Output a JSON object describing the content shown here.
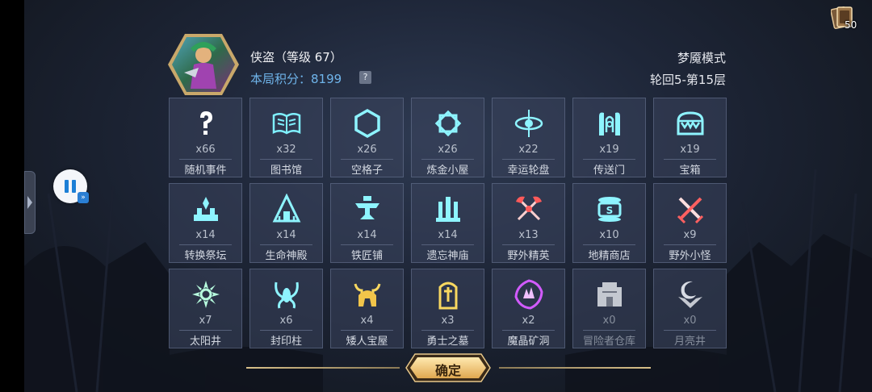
{
  "player": {
    "name": "侠盗（等级 67）",
    "score": "本局积分：8199",
    "score_help": "?"
  },
  "mode": {
    "name": "梦魇模式",
    "floor": "轮回5-第15层"
  },
  "deck": {
    "count": "50",
    "icon": "card-deck-icon"
  },
  "confirm": {
    "label": "确定"
  },
  "accent": {
    "cyan": "#43d9ff",
    "gold": "#f2c54a",
    "red": "#ff5a5a",
    "purple": "#d25bff",
    "gray": "#c4c8d0"
  },
  "grid": {
    "cells": [
      {
        "count": "x66",
        "label": "随机事件",
        "icon": "question-icon"
      },
      {
        "count": "x32",
        "label": "图书馆",
        "icon": "book-icon"
      },
      {
        "count": "x26",
        "label": "空格子",
        "icon": "hexagon-icon"
      },
      {
        "count": "x26",
        "label": "炼金小屋",
        "icon": "alchemy-icon"
      },
      {
        "count": "x22",
        "label": "幸运轮盘",
        "icon": "wheel-icon"
      },
      {
        "count": "x19",
        "label": "传送门",
        "icon": "portal-icon"
      },
      {
        "count": "x19",
        "label": "宝箱",
        "icon": "chest-icon"
      },
      {
        "count": "x14",
        "label": "转换祭坛",
        "icon": "altar-icon"
      },
      {
        "count": "x14",
        "label": "生命神殿",
        "icon": "temple-icon"
      },
      {
        "count": "x14",
        "label": "铁匠铺",
        "icon": "anvil-icon"
      },
      {
        "count": "x14",
        "label": "遗忘神庙",
        "icon": "shrine-icon"
      },
      {
        "count": "x13",
        "label": "野外精英",
        "icon": "elite-axes-icon"
      },
      {
        "count": "x10",
        "label": "地精商店",
        "icon": "shop-icon"
      },
      {
        "count": "x9",
        "label": "野外小怪",
        "icon": "swords-icon"
      },
      {
        "count": "x7",
        "label": "太阳井",
        "icon": "sun-icon"
      },
      {
        "count": "x6",
        "label": "封印柱",
        "icon": "seal-icon"
      },
      {
        "count": "x4",
        "label": "矮人宝屋",
        "icon": "helmet-icon"
      },
      {
        "count": "x3",
        "label": "勇士之墓",
        "icon": "tomb-icon"
      },
      {
        "count": "x2",
        "label": "魔晶矿洞",
        "icon": "crystal-icon"
      },
      {
        "count": "x0",
        "label": "冒险者仓库",
        "icon": "warehouse-icon"
      },
      {
        "count": "x0",
        "label": "月亮井",
        "icon": "moon-icon"
      }
    ]
  }
}
